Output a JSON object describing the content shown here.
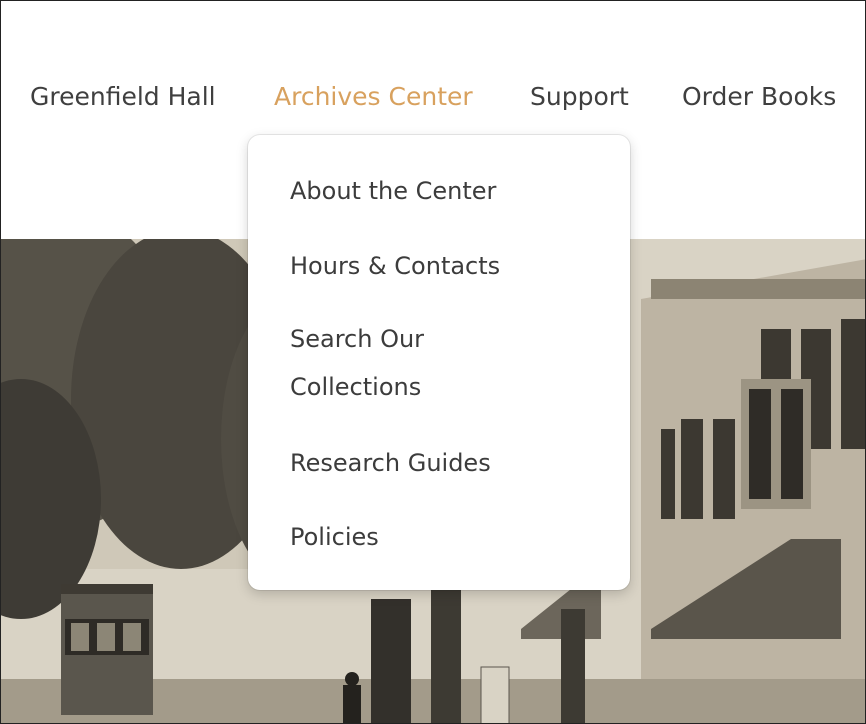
{
  "nav": {
    "items": [
      {
        "label": "Greenfield Hall",
        "active": false
      },
      {
        "label": "Archives Center",
        "active": true
      },
      {
        "label": "Support",
        "active": false
      },
      {
        "label": "Order Books",
        "active": false
      }
    ]
  },
  "dropdown": {
    "items": [
      {
        "label": "About the Center"
      },
      {
        "label": "Hours & Contacts"
      },
      {
        "label": "Search Our Collections"
      },
      {
        "label": "Research Guides"
      },
      {
        "label": "Policies"
      }
    ]
  },
  "colors": {
    "active": "#d8a15e",
    "text": "#3f3f3f"
  },
  "hero": {
    "icon": "historic-street-photo"
  }
}
